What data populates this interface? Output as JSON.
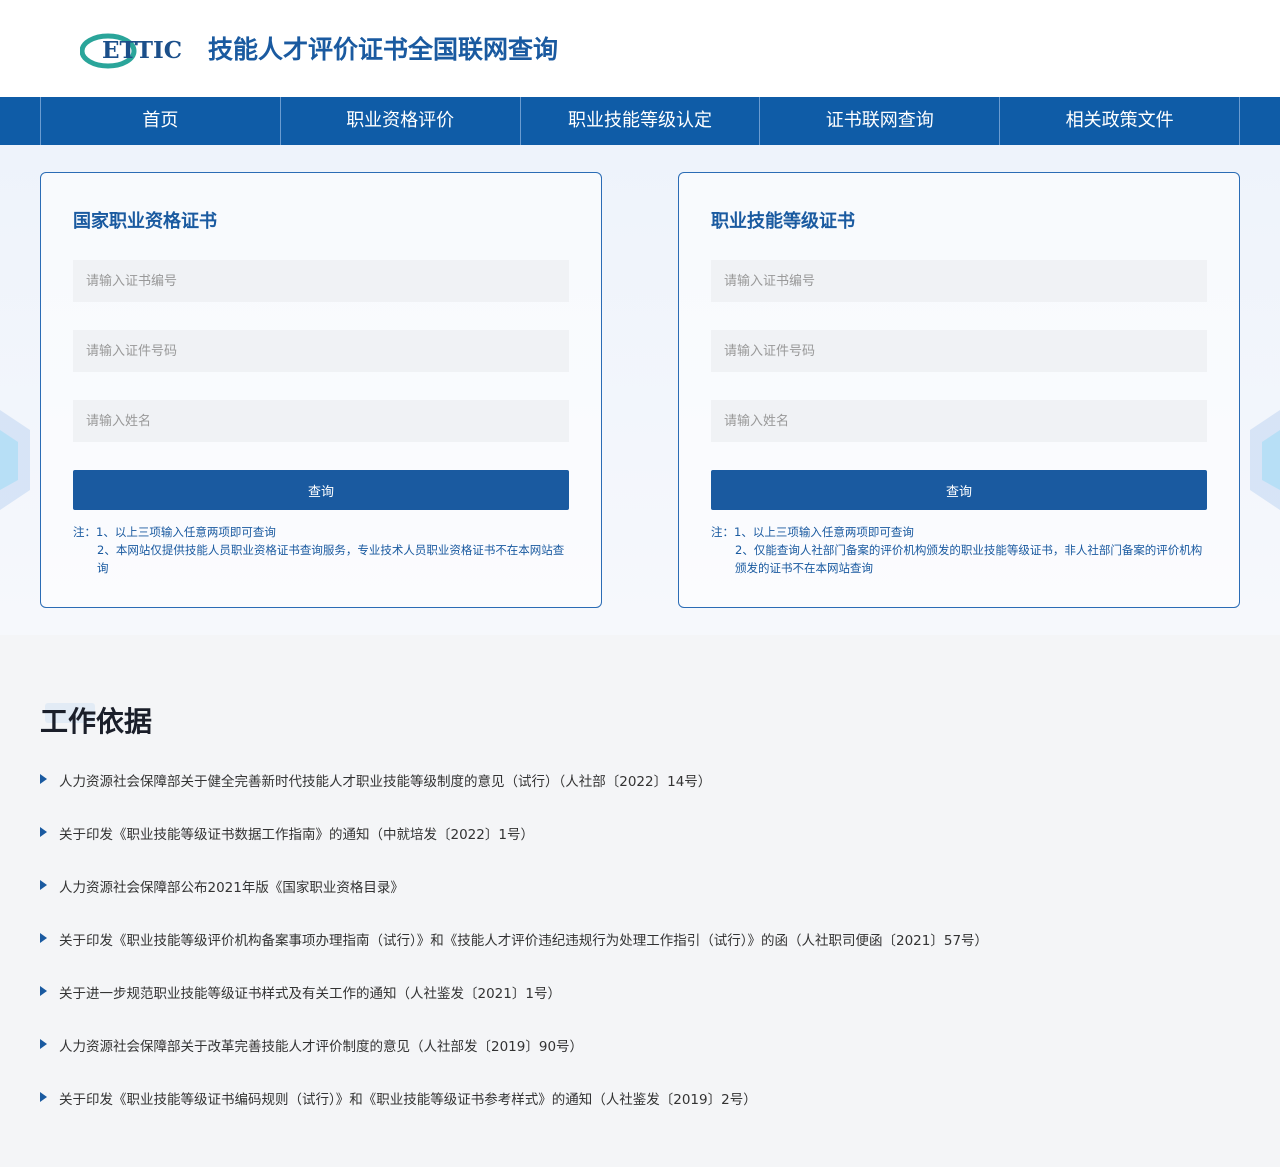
{
  "header": {
    "logo_text": "ETTIC",
    "site_title": "技能人才评价证书全国联网查询"
  },
  "nav": {
    "items": [
      "首页",
      "职业资格评价",
      "职业技能等级认定",
      "证书联网查询",
      "相关政策文件"
    ]
  },
  "cards": {
    "left": {
      "title": "国家职业资格证书",
      "cert_placeholder": "请输入证书编号",
      "id_placeholder": "请输入证件号码",
      "name_placeholder": "请输入姓名",
      "button": "查询",
      "note_1": "注：1、以上三项输入任意两项即可查询",
      "note_2": "2、本网站仅提供技能人员职业资格证书查询服务，专业技术人员职业资格证书不在本网站查询"
    },
    "right": {
      "title": "职业技能等级证书",
      "cert_placeholder": "请输入证书编号",
      "id_placeholder": "请输入证件号码",
      "name_placeholder": "请输入姓名",
      "button": "查询",
      "note_1": "注：1、以上三项输入任意两项即可查询",
      "note_2": "2、仅能查询人社部门备案的评价机构颁发的职业技能等级证书，非人社部门备案的评价机构颁发的证书不在本网站查询"
    }
  },
  "section": {
    "title": "工作依据",
    "items": [
      "人力资源社会保障部关于健全完善新时代技能人才职业技能等级制度的意见（试行）（人社部〔2022〕14号）",
      "关于印发《职业技能等级证书数据工作指南》的通知（中就培发〔2022〕1号）",
      "人力资源社会保障部公布2021年版《国家职业资格目录》",
      "关于印发《职业技能等级评价机构备案事项办理指南（试行）》和《技能人才评价违纪违规行为处理工作指引（试行）》的函（人社职司便函〔2021〕57号）",
      "关于进一步规范职业技能等级证书样式及有关工作的通知（人社鉴发〔2021〕1号）",
      "人力资源社会保障部关于改革完善技能人才评价制度的意见（人社部发〔2019〕90号）",
      "关于印发《职业技能等级证书编码规则（试行）》和《职业技能等级证书参考样式》的通知（人社鉴发〔2019〕2号）"
    ]
  },
  "colors": {
    "nav_bg": "#0f5ca7",
    "brand_blue": "#1a5aa0",
    "logo_teal": "#2aa59a"
  }
}
